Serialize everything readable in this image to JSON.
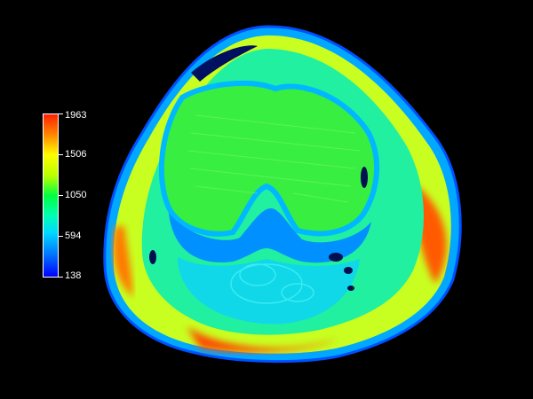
{
  "image": {
    "subject": "knee-mri-axial-color-map"
  },
  "colorbar": {
    "ticks": [
      "1963",
      "1506",
      "1050",
      "594",
      "138"
    ],
    "colors": [
      "#ff2000",
      "#ffff00",
      "#00ff40",
      "#00d8ff",
      "#0000ff"
    ]
  }
}
